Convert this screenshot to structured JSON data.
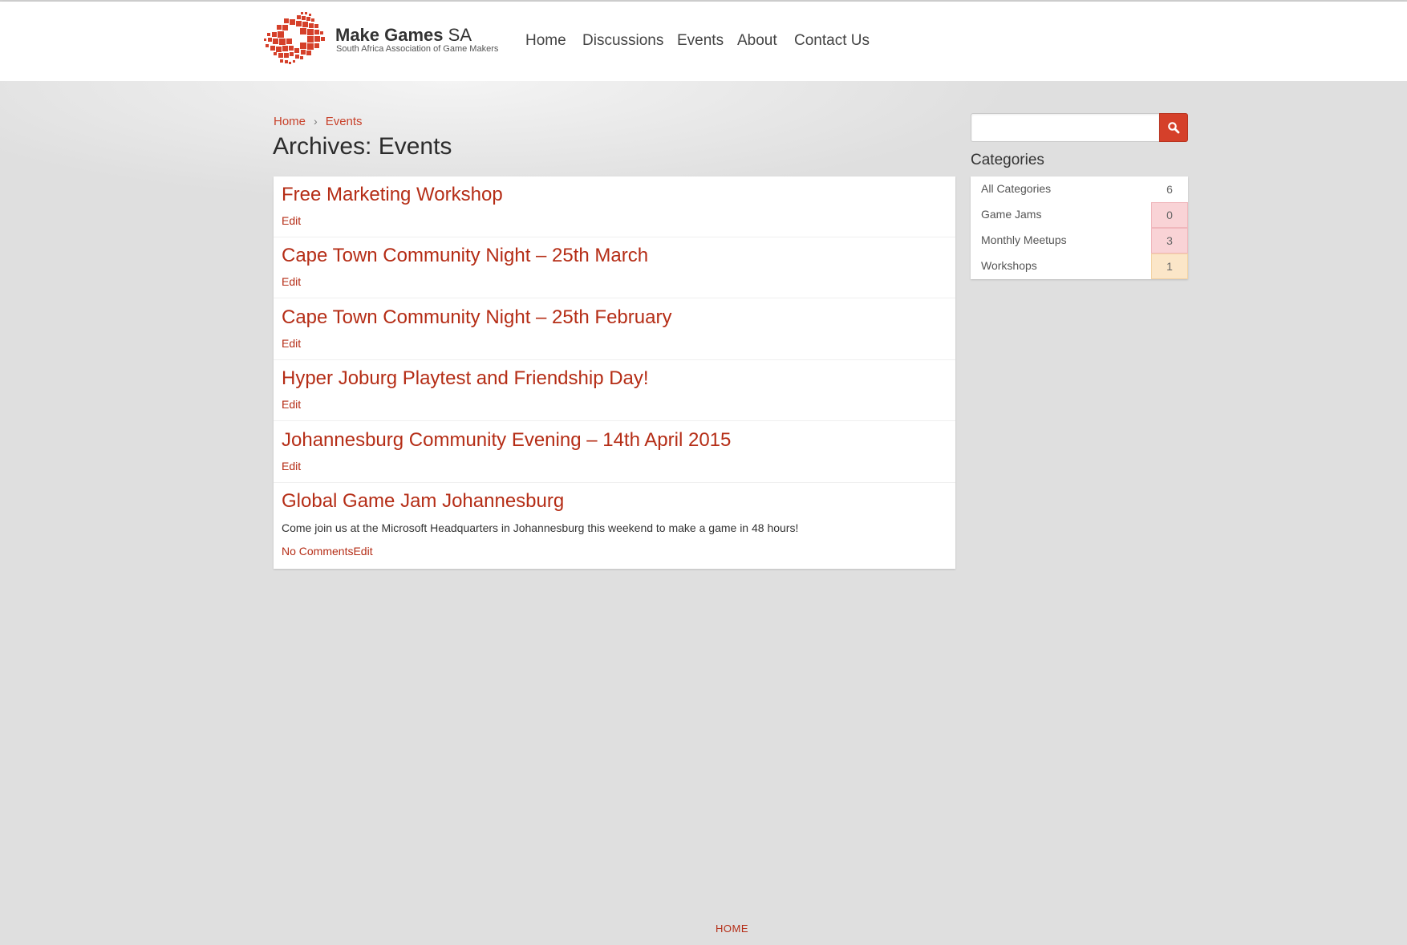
{
  "brand": {
    "title_bold": "Make Games",
    "title_light": " SA",
    "subtitle": "South Africa Association of Game Makers",
    "accent": "#d5402a"
  },
  "nav": {
    "items": [
      "Home",
      "Discussions",
      "Events",
      "About",
      "Contact Us"
    ]
  },
  "breadcrumb": {
    "home": "Home",
    "separator": "›",
    "current": "Events"
  },
  "page": {
    "title": "Archives: Events"
  },
  "posts": [
    {
      "title": "Free Marketing Workshop",
      "edit": "Edit"
    },
    {
      "title": "Cape Town Community Night – 25th March",
      "edit": "Edit"
    },
    {
      "title": "Cape Town Community Night – 25th February",
      "edit": "Edit"
    },
    {
      "title": "Hyper Joburg Playtest and Friendship Day!",
      "edit": "Edit"
    },
    {
      "title": "Johannesburg Community Evening – 14th April 2015",
      "edit": "Edit"
    },
    {
      "title": "Global Game Jam Johannesburg",
      "excerpt": "Come join us at the Microsoft Headquarters in Johannesburg this weekend to make a game in 48 hours!",
      "comments": "No Comments",
      "edit": "Edit"
    }
  ],
  "search": {
    "value": "",
    "placeholder": "",
    "icon": "search-icon"
  },
  "categories": {
    "heading": "Categories",
    "items": [
      {
        "label": "All Categories",
        "count": "6"
      },
      {
        "label": "Game Jams",
        "count": "0"
      },
      {
        "label": "Monthly Meetups",
        "count": "3"
      },
      {
        "label": "Workshops",
        "count": "1"
      }
    ]
  },
  "footer": {
    "home": "HOME"
  }
}
